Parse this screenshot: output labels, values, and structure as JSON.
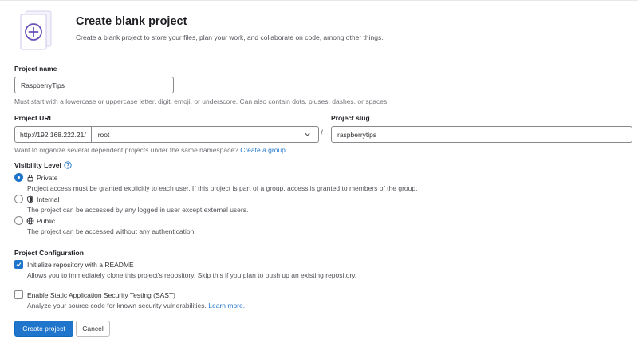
{
  "header": {
    "title": "Create blank project",
    "description": "Create a blank project to store your files, plan your work, and collaborate on code, among other things."
  },
  "project_name": {
    "label": "Project name",
    "value": "RaspberryTips",
    "help": "Must start with a lowercase or uppercase letter, digit, emoji, or underscore. Can also contain dots, pluses, dashes, or spaces."
  },
  "project_url": {
    "label": "Project URL",
    "prefix": "http://192.168.222.21/",
    "namespace": "root",
    "separator": "/",
    "help_text": "Want to organize several dependent projects under the same namespace?",
    "help_link": "Create a group."
  },
  "project_slug": {
    "label": "Project slug",
    "value": "raspberrytips"
  },
  "visibility": {
    "label": "Visibility Level",
    "options": [
      {
        "label": "Private",
        "icon": "lock-icon",
        "description": "Project access must be granted explicitly to each user. If this project is part of a group, access is granted to members of the group.",
        "selected": true
      },
      {
        "label": "Internal",
        "icon": "shield-icon",
        "description": "The project can be accessed by any logged in user except external users.",
        "selected": false
      },
      {
        "label": "Public",
        "icon": "globe-icon",
        "description": "The project can be accessed without any authentication.",
        "selected": false
      }
    ]
  },
  "configuration": {
    "label": "Project Configuration",
    "readme": {
      "label": "Initialize repository with a README",
      "description": "Allows you to immediately clone this project's repository. Skip this if you plan to push up an existing repository.",
      "checked": true
    },
    "sast": {
      "label": "Enable Static Application Security Testing (SAST)",
      "description": "Analyze your source code for known security vulnerabilities.",
      "link": "Learn more.",
      "checked": false
    }
  },
  "actions": {
    "create": "Create project",
    "cancel": "Cancel"
  },
  "colors": {
    "primary": "#1f75cb",
    "illustration_purple": "#6b4fbb",
    "text": "#333238"
  }
}
